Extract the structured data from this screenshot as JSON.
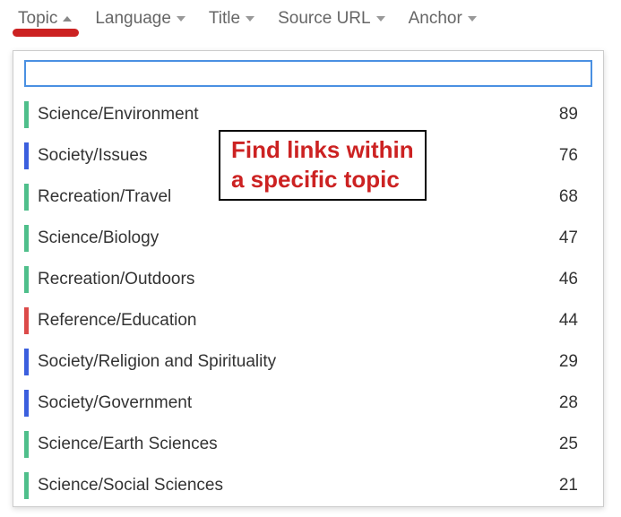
{
  "columns": [
    {
      "label": "Topic",
      "direction": "up",
      "active": true
    },
    {
      "label": "Language",
      "direction": "down",
      "active": false
    },
    {
      "label": "Title",
      "direction": "down",
      "active": false
    },
    {
      "label": "Source URL",
      "direction": "down",
      "active": false
    },
    {
      "label": "Anchor",
      "direction": "down",
      "active": false
    }
  ],
  "search": {
    "value": "",
    "placeholder": ""
  },
  "topic_colors": {
    "green": "#4fbf8b",
    "blue": "#3b5fde",
    "red": "#dc4a49"
  },
  "topics": [
    {
      "label": "Science/Environment",
      "count": 89,
      "color": "green"
    },
    {
      "label": "Society/Issues",
      "count": 76,
      "color": "blue"
    },
    {
      "label": "Recreation/Travel",
      "count": 68,
      "color": "green"
    },
    {
      "label": "Science/Biology",
      "count": 47,
      "color": "green"
    },
    {
      "label": "Recreation/Outdoors",
      "count": 46,
      "color": "green"
    },
    {
      "label": "Reference/Education",
      "count": 44,
      "color": "red"
    },
    {
      "label": "Society/Religion and Spirituality",
      "count": 29,
      "color": "blue"
    },
    {
      "label": "Society/Government",
      "count": 28,
      "color": "blue"
    },
    {
      "label": "Science/Earth Sciences",
      "count": 25,
      "color": "green"
    },
    {
      "label": "Science/Social Sciences",
      "count": 21,
      "color": "green"
    }
  ],
  "callout": {
    "line1": "Find links within",
    "line2": "a specific topic"
  }
}
